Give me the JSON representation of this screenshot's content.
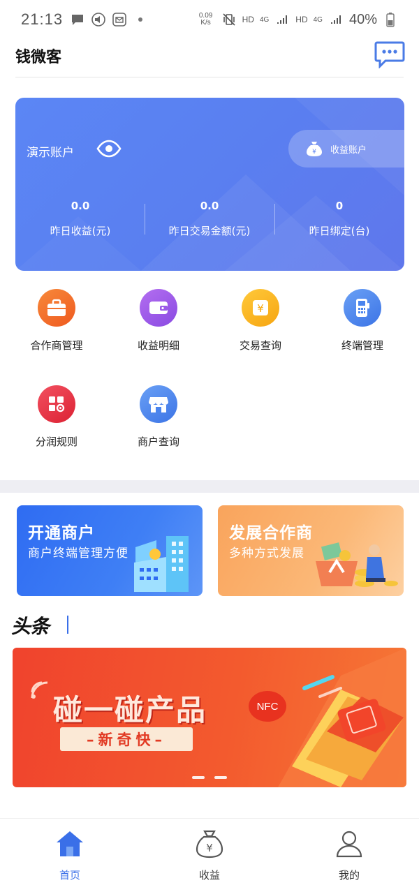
{
  "status_bar": {
    "time": "21:13",
    "network_speed": "0.09\nK/s",
    "hd1": "HD",
    "net1": "4G",
    "hd2": "HD",
    "net2": "4G",
    "battery": "40%"
  },
  "header": {
    "title": "钱微客"
  },
  "account_card": {
    "label": "演示账户",
    "earn_account_label": "收益账户",
    "stats": [
      {
        "value": "0.0",
        "label": "昨日收益(元)"
      },
      {
        "value": "0.0",
        "label": "昨日交易金额(元)"
      },
      {
        "value": "0",
        "label": "昨日绑定(台)"
      }
    ]
  },
  "menu": [
    {
      "label": "合作商管理",
      "icon": "briefcase-icon",
      "color": "#f26a25"
    },
    {
      "label": "收益明细",
      "icon": "wallet-icon",
      "color": "#9c5ae8"
    },
    {
      "label": "交易查询",
      "icon": "yen-box-icon",
      "color": "#f8b31a"
    },
    {
      "label": "终端管理",
      "icon": "pos-terminal-icon",
      "color": "#4a84ee"
    },
    {
      "label": "分润规则",
      "icon": "grid-settings-icon",
      "color": "#ea3240"
    },
    {
      "label": "商户查询",
      "icon": "shop-icon",
      "color": "#4a84ee"
    }
  ],
  "promos": [
    {
      "title": "开通商户",
      "subtitle": "商户终端管理方便"
    },
    {
      "title": "发展合作商",
      "subtitle": "多种方式发展"
    }
  ],
  "headline": {
    "logo": "头条"
  },
  "banner": {
    "title": "碰一碰产品",
    "subtitle": "–新奇快–",
    "nfc": "NFC"
  },
  "bottom_nav": [
    {
      "label": "首页",
      "active": true
    },
    {
      "label": "收益",
      "active": false
    },
    {
      "label": "我的",
      "active": false
    }
  ]
}
